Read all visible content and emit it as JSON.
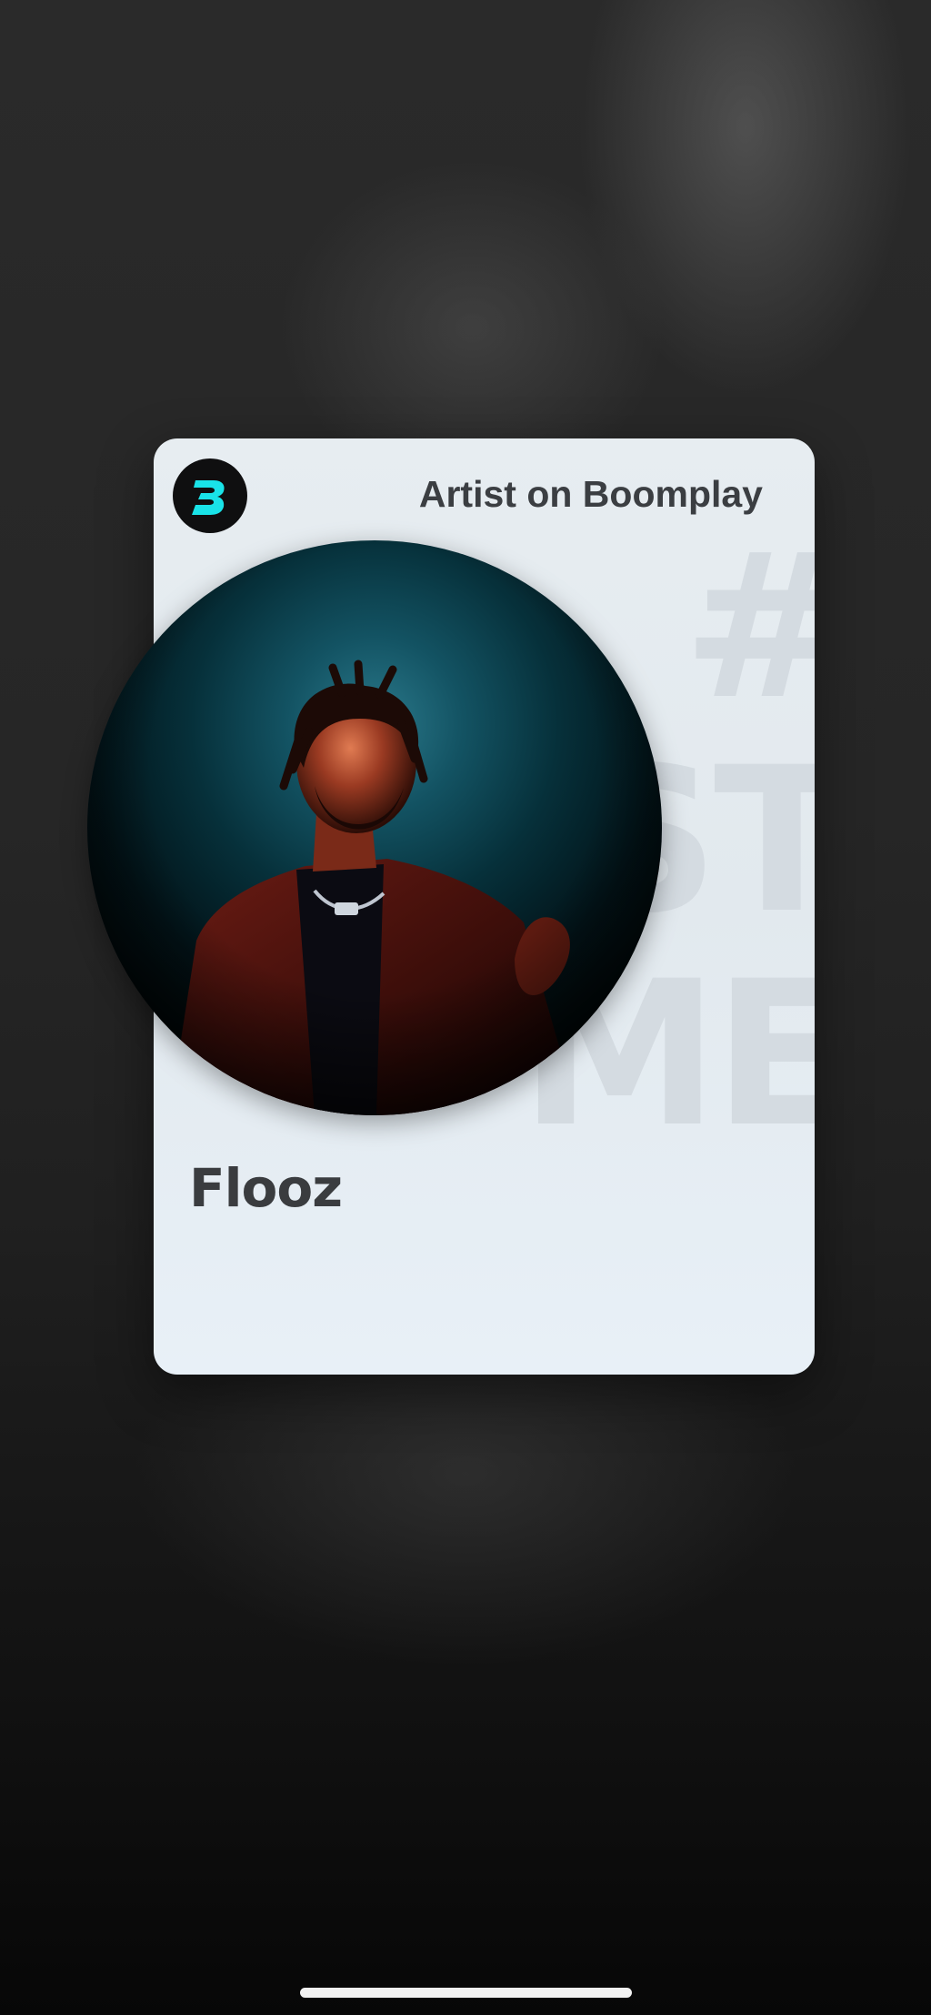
{
  "card": {
    "heading": "Artist on Boomplay",
    "artist_name": "Flooz",
    "logo_icon": "boomplay-logo-icon",
    "photo_icon": "artist-photo"
  },
  "colors": {
    "card_bg": "#e7edf1",
    "logo_bg": "#0f0f10",
    "logo_accent": "#19e3e8",
    "text_dark": "#3b3e42"
  }
}
